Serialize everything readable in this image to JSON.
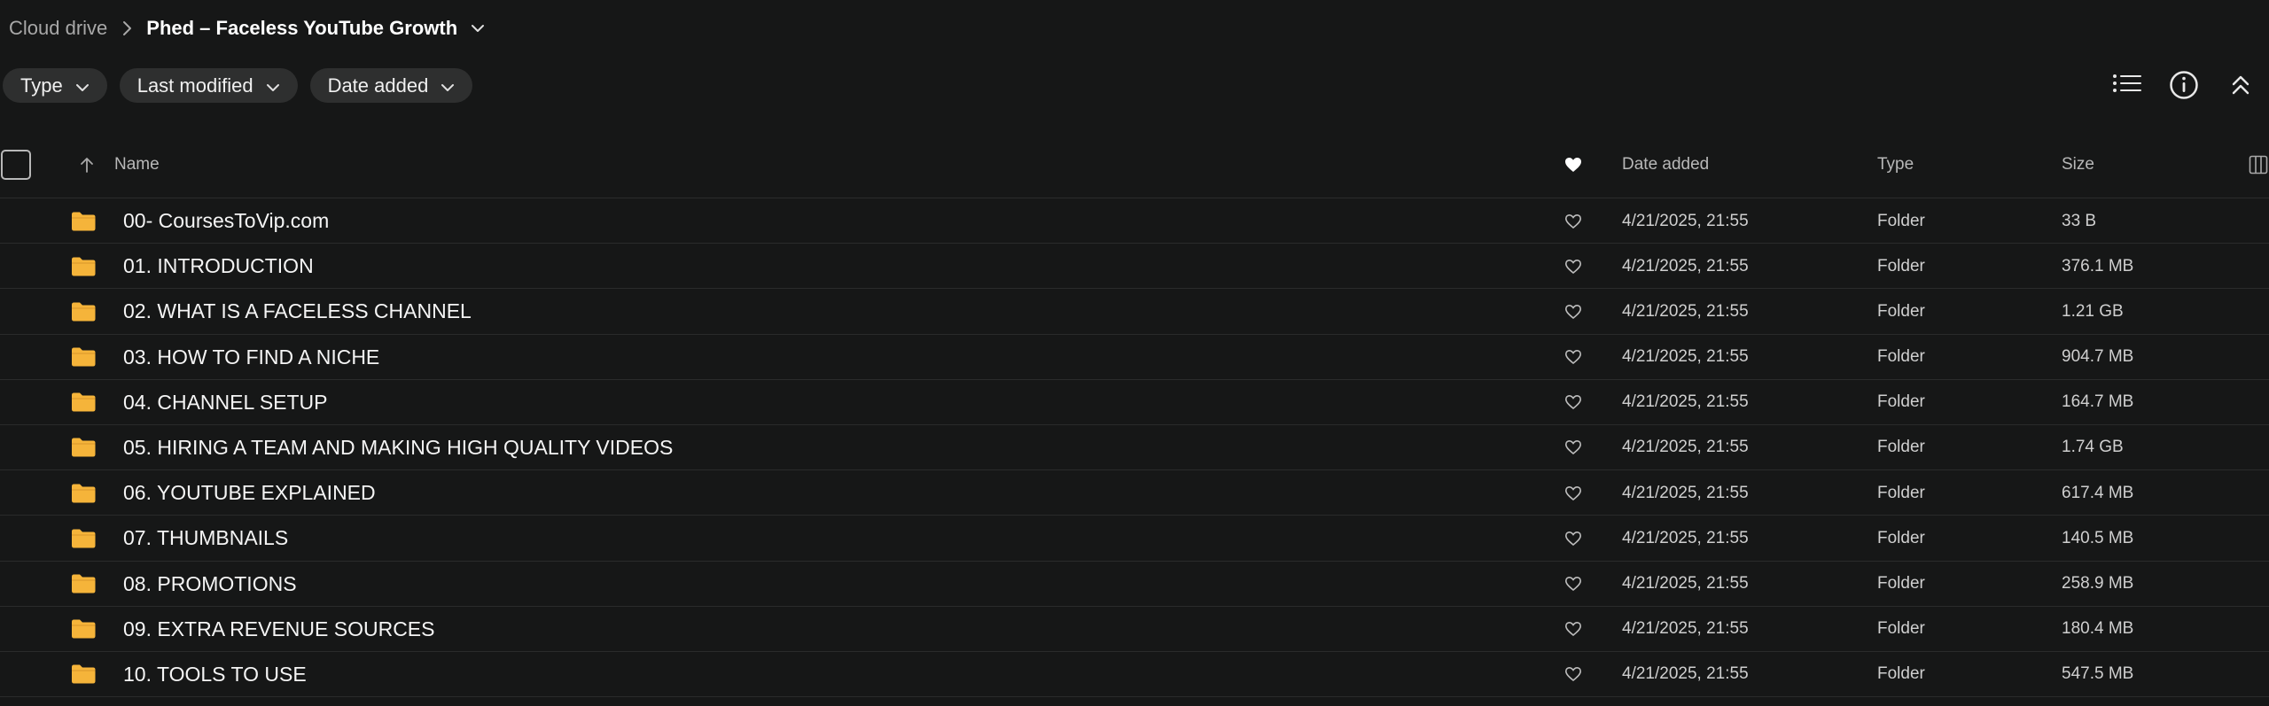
{
  "breadcrumb": {
    "root": "Cloud drive",
    "current": "Phed – Faceless YouTube Growth"
  },
  "filters": [
    {
      "label": "Type"
    },
    {
      "label": "Last modified"
    },
    {
      "label": "Date added"
    }
  ],
  "table": {
    "headers": {
      "name": "Name",
      "date_added": "Date added",
      "type": "Type",
      "size": "Size"
    },
    "rows": [
      {
        "name": "00- CoursesToVip.com",
        "date_added": "4/21/2025, 21:55",
        "type": "Folder",
        "size": "33 B"
      },
      {
        "name": "01. INTRODUCTION",
        "date_added": "4/21/2025, 21:55",
        "type": "Folder",
        "size": "376.1 MB"
      },
      {
        "name": "02. WHAT IS A FACELESS CHANNEL",
        "date_added": "4/21/2025, 21:55",
        "type": "Folder",
        "size": "1.21 GB"
      },
      {
        "name": "03. HOW TO FIND A NICHE",
        "date_added": "4/21/2025, 21:55",
        "type": "Folder",
        "size": "904.7 MB"
      },
      {
        "name": "04. CHANNEL SETUP",
        "date_added": "4/21/2025, 21:55",
        "type": "Folder",
        "size": "164.7 MB"
      },
      {
        "name": "05. HIRING A TEAM AND MAKING HIGH QUALITY VIDEOS",
        "date_added": "4/21/2025, 21:55",
        "type": "Folder",
        "size": "1.74 GB"
      },
      {
        "name": "06. YOUTUBE EXPLAINED",
        "date_added": "4/21/2025, 21:55",
        "type": "Folder",
        "size": "617.4 MB"
      },
      {
        "name": "07. THUMBNAILS",
        "date_added": "4/21/2025, 21:55",
        "type": "Folder",
        "size": "140.5 MB"
      },
      {
        "name": "08. PROMOTIONS",
        "date_added": "4/21/2025, 21:55",
        "type": "Folder",
        "size": "258.9 MB"
      },
      {
        "name": "09. EXTRA REVENUE SOURCES",
        "date_added": "4/21/2025, 21:55",
        "type": "Folder",
        "size": "180.4 MB"
      },
      {
        "name": "10. TOOLS TO USE",
        "date_added": "4/21/2025, 21:55",
        "type": "Folder",
        "size": "547.5 MB"
      }
    ]
  },
  "icons": {
    "folder": "folder-icon",
    "favorite": "heart-icon",
    "list_view": "list-view-icon",
    "info": "info-icon",
    "collapse": "collapse-icon"
  },
  "colors": {
    "background": "#161717",
    "folder": "#f5b43a",
    "chip": "#2e2f2f"
  }
}
